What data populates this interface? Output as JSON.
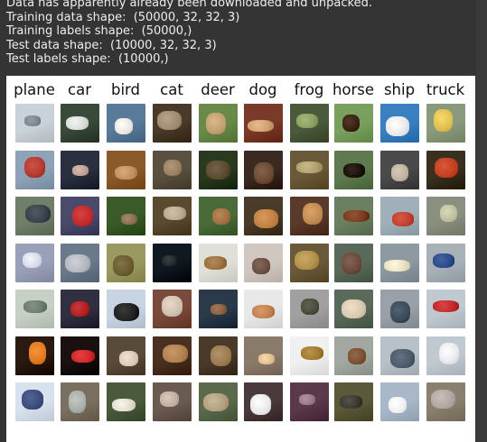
{
  "console": {
    "lines": [
      "Data has apparently already been downloaded and unpacked.",
      "Training data shape:  (50000, 32, 32, 3)",
      "Training labels shape:  (50000,)",
      "Test data shape:  (10000, 32, 32, 3)",
      "Test labels shape:  (10000,)"
    ]
  },
  "figure": {
    "classes": [
      "plane",
      "car",
      "bird",
      "cat",
      "deer",
      "dog",
      "frog",
      "horse",
      "ship",
      "truck"
    ],
    "samples_per_class": 7,
    "palette": {
      "plane": [
        [
          "#c9d2d8",
          "#7c848c"
        ],
        [
          "#8fa3b8",
          "#b23a2e"
        ],
        [
          "#6f7f6a",
          "#37414a"
        ],
        [
          "#9aa0b8",
          "#d8dce8"
        ],
        [
          "#c7d0c4",
          "#6d7a6e"
        ],
        [
          "#2a1a10",
          "#e07a20"
        ],
        [
          "#d8e2ee",
          "#3a4d7a"
        ]
      ],
      "car": [
        [
          "#3a4a3a",
          "#d8dcd8"
        ],
        [
          "#2a3040",
          "#c0a090"
        ],
        [
          "#4a4a6a",
          "#c02a2a"
        ],
        [
          "#6a7a8a",
          "#b4b8c0"
        ],
        [
          "#303040",
          "#b02020"
        ],
        [
          "#1a1010",
          "#d02828"
        ],
        [
          "#7a7060",
          "#aab0a8"
        ]
      ],
      "bird": [
        [
          "#5a7a9a",
          "#e8e8e0"
        ],
        [
          "#8a5a2a",
          "#c09060"
        ],
        [
          "#3a5a2a",
          "#8a7050"
        ],
        [
          "#9a9a60",
          "#6a5a30"
        ],
        [
          "#c8d4e4",
          "#202020"
        ],
        [
          "#5a4a3a",
          "#d8c8b8"
        ],
        [
          "#4a5a3a",
          "#e0dcd0"
        ]
      ],
      "cat": [
        [
          "#4a3a2a",
          "#a08a70"
        ],
        [
          "#5a5040",
          "#9a8060"
        ],
        [
          "#5a4a30",
          "#b8a890"
        ],
        [
          "#101820",
          "#202a2a"
        ],
        [
          "#7a4a3a",
          "#d0c0b0"
        ],
        [
          "#4a3020",
          "#b08050"
        ],
        [
          "#6a5a50",
          "#c0b0a0"
        ]
      ],
      "deer": [
        [
          "#6a8a4a",
          "#c0a070"
        ],
        [
          "#2a3a20",
          "#5a4a30"
        ],
        [
          "#4a6a3a",
          "#a07040"
        ],
        [
          "#e0e0d8",
          "#9a7040"
        ],
        [
          "#2a3a4a",
          "#8a6040"
        ],
        [
          "#4a3a2a",
          "#9a7a50"
        ],
        [
          "#5a6a4a",
          "#b0a080"
        ]
      ],
      "dog": [
        [
          "#7a3a2a",
          "#d0a070"
        ],
        [
          "#3a2a20",
          "#6a4a30"
        ],
        [
          "#4a3a2a",
          "#c08040"
        ],
        [
          "#d0c8c0",
          "#6a5040"
        ],
        [
          "#e8e8e8",
          "#c08050"
        ],
        [
          "#8a7a6a",
          "#e0c090"
        ],
        [
          "#4a3a3a",
          "#e8e8e8"
        ]
      ],
      "frog": [
        [
          "#4a5a3a",
          "#8aa060"
        ],
        [
          "#6a5a3a",
          "#b0a070"
        ],
        [
          "#5a3a2a",
          "#c08a50"
        ],
        [
          "#6a5a3a",
          "#b0904a"
        ],
        [
          "#a0a0a0",
          "#4a4a3a"
        ],
        [
          "#f0f0f0",
          "#a07a30"
        ],
        [
          "#5a3a4a",
          "#9a7a8a"
        ]
      ],
      "horse": [
        [
          "#7aa060",
          "#3a2010"
        ],
        [
          "#607a50",
          "#1a1008"
        ],
        [
          "#6a8060",
          "#7a3a20"
        ],
        [
          "#5a6a5a",
          "#6a4a3a"
        ],
        [
          "#5a6a5a",
          "#d8c8b0"
        ],
        [
          "#a0a8a0",
          "#7a5030"
        ],
        [
          "#5a5a3a",
          "#3a3a30"
        ]
      ],
      "ship": [
        [
          "#3a80c0",
          "#e8e8e8"
        ],
        [
          "#4a4a4a",
          "#c0b0a0"
        ],
        [
          "#a0b0b8",
          "#c04030"
        ],
        [
          "#8a9aa0",
          "#e8e0c0"
        ],
        [
          "#9aa0a8",
          "#3a4a5a"
        ],
        [
          "#b8c0c8",
          "#4a5a6a"
        ],
        [
          "#a8b8c8",
          "#f0f0f0"
        ]
      ],
      "truck": [
        [
          "#8a9a7a",
          "#e0c050"
        ],
        [
          "#3a3020",
          "#c04020"
        ],
        [
          "#8a9080",
          "#c0c0a0"
        ],
        [
          "#a8b0b8",
          "#2a4a8a"
        ],
        [
          "#c0c8d0",
          "#c02a2a"
        ],
        [
          "#c0c8d0",
          "#e8e8f0"
        ],
        [
          "#8a8070",
          "#b0a8a0"
        ]
      ]
    }
  }
}
